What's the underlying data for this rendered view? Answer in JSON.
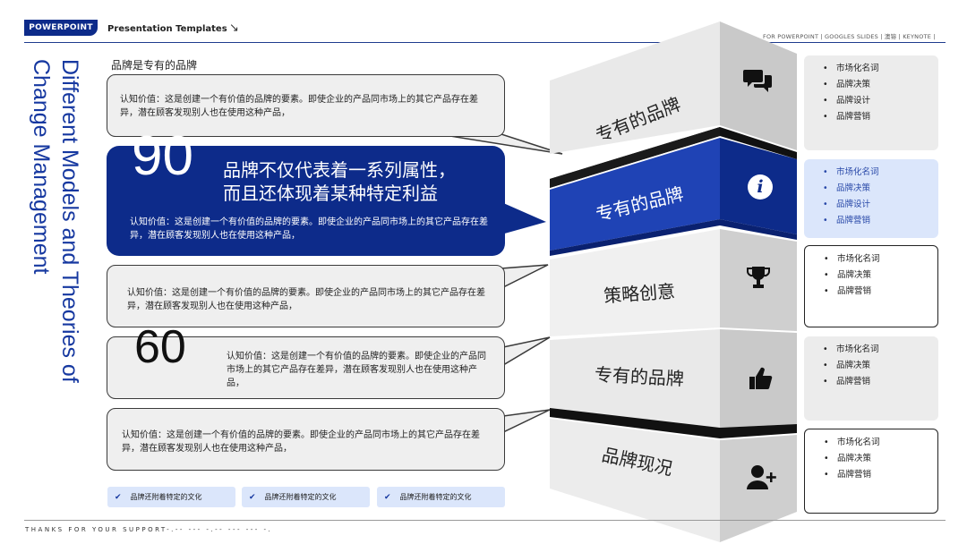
{
  "header": {
    "badge": "POWERPOINT",
    "title": "Presentation Templates",
    "arrow": "↘",
    "right_text": "FOR POWERPOINT | GOOGLES SLIDES | 澳镕 | KEYNOTE |"
  },
  "side_title": "Different Models and Theories of Change Management",
  "subtitle": "品牌是专有的品牌",
  "boxes": [
    {
      "text": "认知价值：这是创建一个有价值的品牌的要素。即使企业的产品同市场上的其它产品存在差异，潜在顾客发现别人也在使用这种产品，"
    },
    {
      "number": "90",
      "headline_1": "品牌不仅代表着一系列属性，",
      "headline_2": "而且还体现着某种特定利益",
      "text": "认知价值：这是创建一个有价值的品牌的要素。即使企业的产品同市场上的其它产品存在差异，潜在顾客发现别人也在使用这种产品，"
    },
    {
      "text": "认知价值：这是创建一个有价值的品牌的要素。即使企业的产品同市场上的其它产品存在差异，潜在顾客发现别人也在使用这种产品，"
    },
    {
      "number": "60",
      "text": "认知价值：这是创建一个有价值的品牌的要素。即使企业的产品同市场上的其它产品存在差异，潜在顾客发现别人也在使用这种产品，"
    },
    {
      "text": "认知价值：这是创建一个有价值的品牌的要素。即使企业的产品同市场上的其它产品存在差异，潜在顾客发现别人也在使用这种产品，"
    }
  ],
  "tower": {
    "labels": [
      "专有的品牌",
      "专有的品牌",
      "策略创意",
      "专有的品牌",
      "品牌现况"
    ],
    "icons": [
      "chat-icon",
      "info-icon",
      "trophy-icon",
      "thumbs-up-icon",
      "add-user-icon"
    ],
    "info_glyph": "i"
  },
  "lists": [
    {
      "items": [
        "市场化名词",
        "品牌决策",
        "品牌设计",
        "品牌营销"
      ]
    },
    {
      "items": [
        "市场化名词",
        "品牌决策",
        "品牌设计",
        "品牌营销"
      ]
    },
    {
      "items": [
        "市场化名词",
        "品牌决策",
        "品牌营销"
      ]
    },
    {
      "items": [
        "市场化名词",
        "品牌决策",
        "品牌营销"
      ]
    },
    {
      "items": [
        "市场化名词",
        "品牌决策",
        "品牌营销"
      ]
    }
  ],
  "chips": [
    {
      "check": "✔",
      "label": "品牌还附着特定的文化"
    },
    {
      "check": "✔",
      "label": "品牌还附着特定的文化"
    },
    {
      "check": "✔",
      "label": "品牌还附着特定的文化"
    }
  ],
  "footer": "THANKS FOR YOUR SUPPORT-.-- --- -.-- --- --- -.",
  "colors": {
    "brand": "#0d2b8a",
    "accent": "#1638a0",
    "light_blue": "#dbe6fb",
    "gray": "#ececec"
  }
}
